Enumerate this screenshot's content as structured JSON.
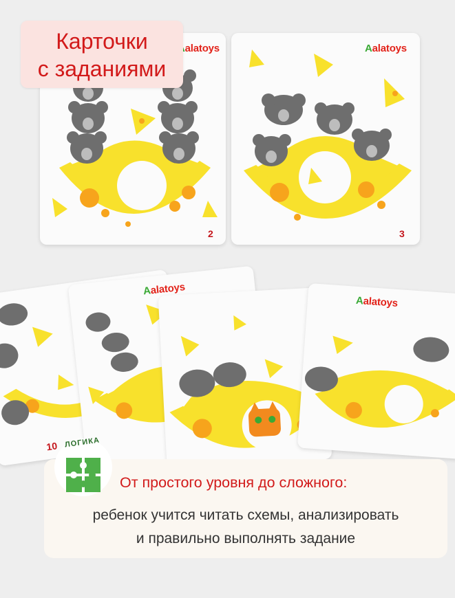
{
  "title": {
    "line1": "Карточки",
    "line2": "с заданиями"
  },
  "brand": {
    "lead": "A",
    "rest": "alatoys"
  },
  "cards": [
    {
      "number": "2"
    },
    {
      "number": "3"
    },
    {
      "number": "10"
    }
  ],
  "badge": {
    "label": "ЛОГИКА",
    "icon": "puzzle-icon"
  },
  "info": {
    "headline": "От простого уровня до сложного:",
    "line1": "ребенок учится читать схемы, анализировать",
    "line2": "и правильно выполнять задание"
  },
  "colors": {
    "accent_red": "#d21a1a",
    "badge_bg": "#fbe3e0",
    "cheese": "#f8e12c",
    "cheese_hole": "#f7a41c",
    "mouse": "#6e6e6e",
    "brand_green": "#3aa935"
  }
}
